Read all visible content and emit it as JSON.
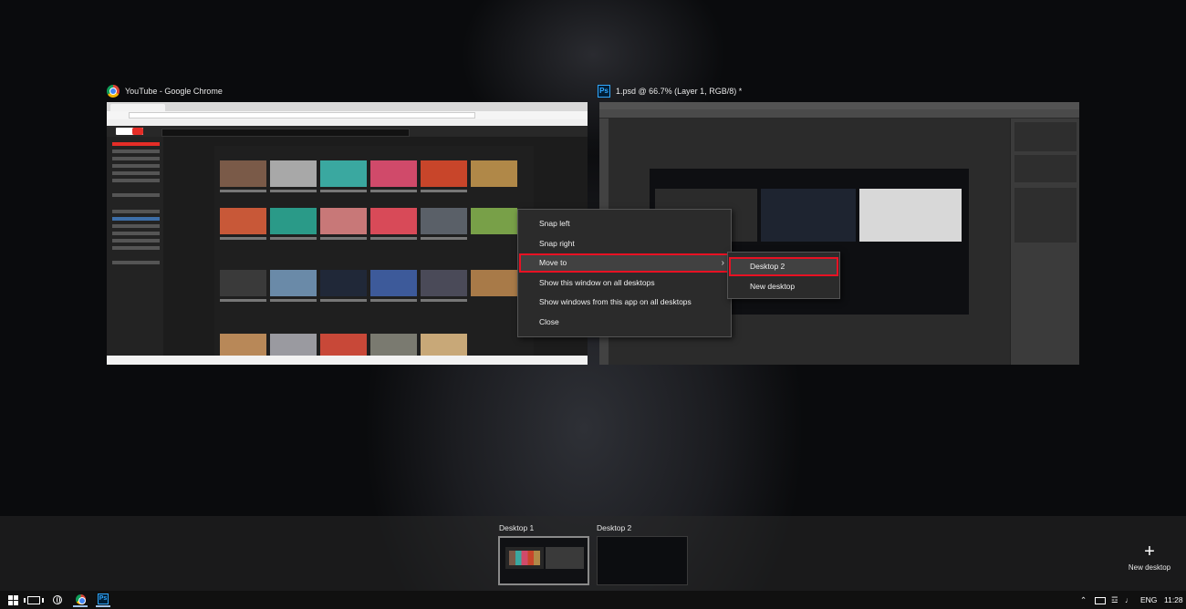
{
  "windows": {
    "chrome": {
      "title": "YouTube - Google Chrome",
      "icon": "chrome-icon"
    },
    "photoshop": {
      "title": "1.psd @ 66.7% (Layer 1, RGB/8) *",
      "icon": "photoshop-icon",
      "icon_text": "Ps"
    }
  },
  "context_menu": {
    "items": [
      {
        "label": "Snap left"
      },
      {
        "label": "Snap right"
      },
      {
        "label": "Move to",
        "submenu_arrow": "›"
      },
      {
        "label": "Show this window on all desktops"
      },
      {
        "label": "Show windows from this app on all desktops"
      },
      {
        "label": "Close"
      }
    ],
    "highlighted": "Move to",
    "highlight_color": "#e81123"
  },
  "submenu": {
    "items": [
      {
        "label": "Desktop 2"
      },
      {
        "label": "New desktop"
      }
    ],
    "highlighted": "Desktop 2"
  },
  "desktops": {
    "items": [
      {
        "label": "Desktop 1",
        "active": true
      },
      {
        "label": "Desktop 2",
        "active": false
      }
    ],
    "new_desktop_label": "New desktop",
    "new_desktop_icon": "plus-icon"
  },
  "taskbar": {
    "language": "ENG",
    "time": "11:28"
  },
  "colors": {
    "youtube_red": "#e52d27",
    "highlight": "#e81123",
    "menu_bg": "#2b2b2b"
  }
}
